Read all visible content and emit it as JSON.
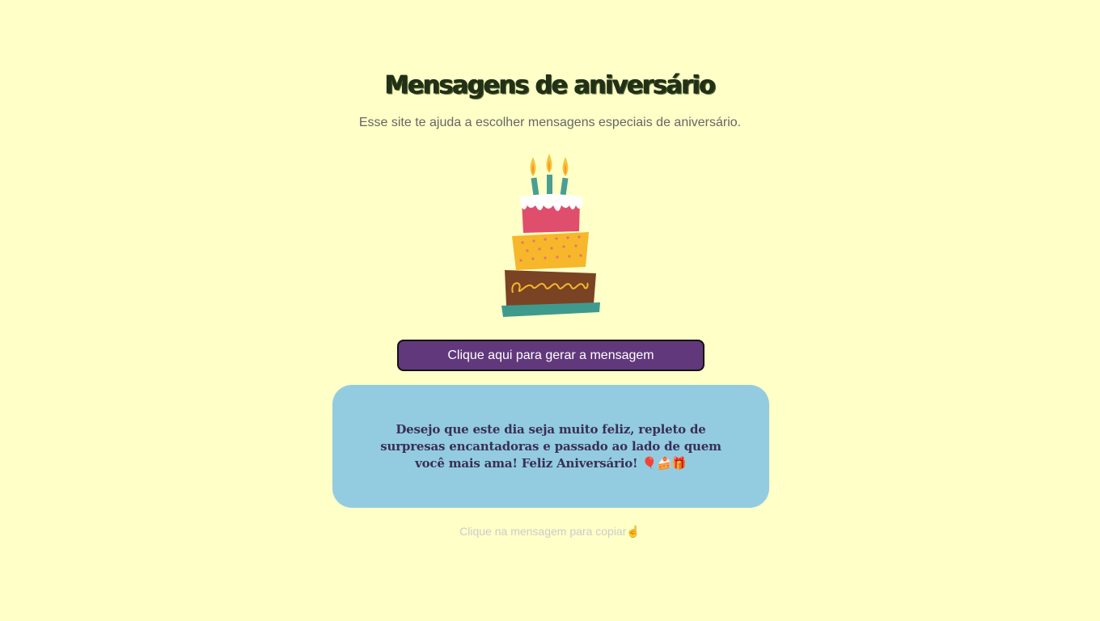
{
  "header": {
    "title": "Mensagens de aniversário",
    "subtitle": "Esse site te ajuda a escolher mensagens especiais de aniversário."
  },
  "illustration": {
    "icon": "birthday-cake-icon",
    "colors": {
      "tier_top": "#e04e6d",
      "frosting": "#ffffff",
      "tier_middle": "#f6b72b",
      "tier_bottom": "#7a4324",
      "plate": "#3f9a8e",
      "candle": "#4a9e92",
      "flame": "#f7c23b"
    }
  },
  "generator": {
    "button_label": "Clique aqui para gerar a mensagem",
    "button_color": "#62387c"
  },
  "message": {
    "text": "Desejo que este dia seja muito feliz, repleto de surpresas encantadoras e passado ao lado de quem você mais ama! Feliz Aniversário! 🎈🍰🎁",
    "background": "#93cce0"
  },
  "copy_hint": {
    "text": "Clique na mensagem para copiar☝"
  },
  "theme": {
    "background": "#ffffc8"
  }
}
